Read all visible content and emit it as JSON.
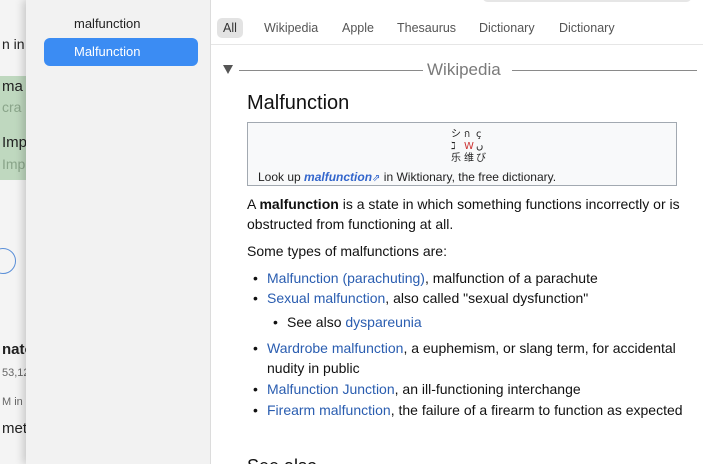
{
  "background_app": {
    "fragments": [
      "n in",
      "ma",
      "cra",
      "Imp",
      "Imp",
      "nato",
      "53,12",
      "M in r",
      "met"
    ]
  },
  "sidebar": {
    "items": [
      {
        "label": "malfunction",
        "selected": false
      },
      {
        "label": "Malfunction",
        "selected": true
      }
    ]
  },
  "tabs": [
    {
      "label": "All",
      "selected": true
    },
    {
      "label": "Wikipedia",
      "selected": false
    },
    {
      "label": "Apple",
      "selected": false
    },
    {
      "label": "Thesaurus",
      "selected": false
    },
    {
      "label": "Dictionary",
      "selected": false
    },
    {
      "label": "Dictionary",
      "selected": false
    }
  ],
  "section": {
    "title": "Wikipedia"
  },
  "entry": {
    "title": "Malfunction",
    "wiktionary": {
      "prefix": "Look up ",
      "word": "malfunction",
      "suffix": " in Wiktionary, the free dictionary."
    },
    "intro": {
      "a": "A ",
      "bold": "malfunction",
      "rest": " is a state in which something functions incorrectly or is obstructed from functioning at all."
    },
    "types_intro": "Some types of malfunctions are:",
    "list": [
      {
        "link": "Malfunction (parachuting)",
        "text": ", malfunction of a parachute"
      },
      {
        "link": "Sexual malfunction",
        "text": ", also called \"sexual dysfunction\""
      },
      {
        "link": "Wardrobe malfunction",
        "text": ", a euphemism, or slang term, for accidental nudity in public"
      },
      {
        "link": "Malfunction Junction",
        "text": ", an ill-functioning interchange"
      },
      {
        "link": "Firearm malfunction",
        "text": ", the failure of a firearm to function as expected"
      }
    ],
    "sub_list": {
      "prefix": "See also ",
      "link": "dyspareunia"
    },
    "next_heading_cut": "See also"
  },
  "colors": {
    "accent": "#3b8cf3",
    "link": "#2a5db0"
  }
}
